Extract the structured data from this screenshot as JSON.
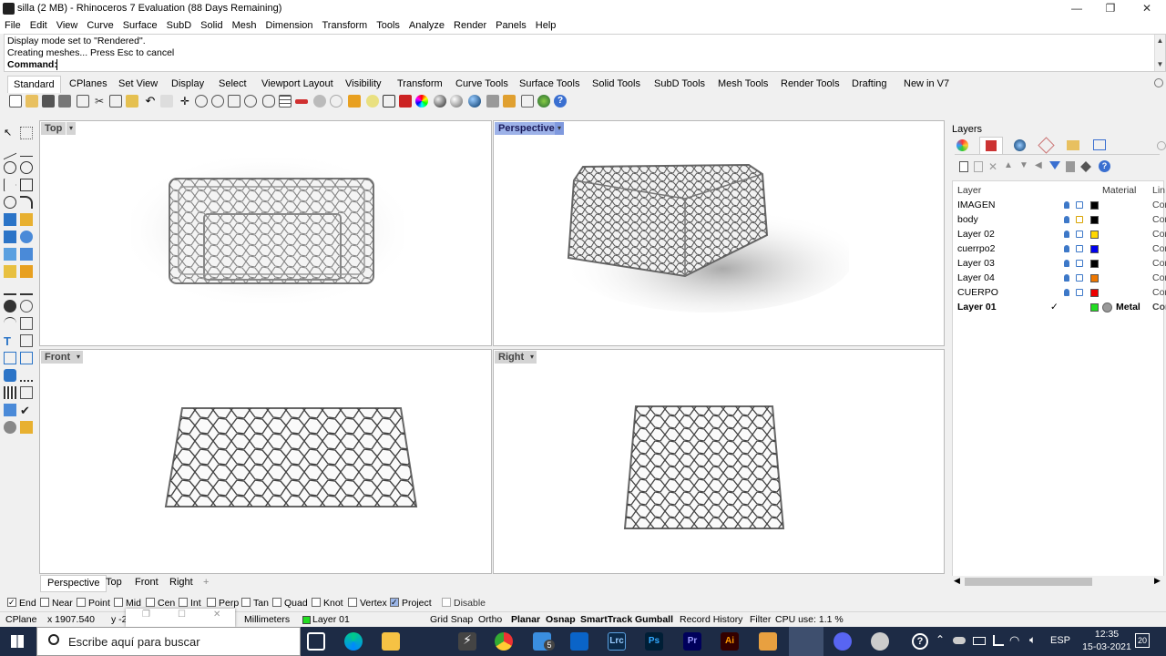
{
  "window": {
    "title": "silla (2 MB) - Rhinoceros 7 Evaluation (88 Days Remaining)",
    "min_icon": "—",
    "max_icon": "❐",
    "close_icon": "✕"
  },
  "menu": [
    "File",
    "Edit",
    "View",
    "Curve",
    "Surface",
    "SubD",
    "Solid",
    "Mesh",
    "Dimension",
    "Transform",
    "Tools",
    "Analyze",
    "Render",
    "Panels",
    "Help"
  ],
  "command": {
    "history": [
      "Display mode set to \"Rendered\".",
      "Creating meshes... Press Esc to cancel"
    ],
    "prompt": "Command:"
  },
  "toolbar_tabs": [
    "Standard",
    "CPlanes",
    "Set View",
    "Display",
    "Select",
    "Viewport Layout",
    "Visibility",
    "Transform",
    "Curve Tools",
    "Surface Tools",
    "Solid Tools",
    "SubD Tools",
    "Mesh Tools",
    "Render Tools",
    "Drafting",
    "New in V7"
  ],
  "viewports": {
    "top": "Top",
    "perspective": "Perspective",
    "front": "Front",
    "right": "Right",
    "dropdown": "▾"
  },
  "viewport_tabs": [
    "Perspective",
    "Top",
    "Front",
    "Right",
    "+"
  ],
  "layers": {
    "title": "Layers",
    "headers": {
      "layer": "Layer",
      "material": "Material",
      "linetype": "Lin"
    },
    "rows": [
      {
        "name": "IMAGEN",
        "color": "#000000",
        "linetype": "Cor"
      },
      {
        "name": "body",
        "color": "#000000",
        "linetype": "Cor"
      },
      {
        "name": "Layer 02",
        "color": "#ffd700",
        "linetype": "Cor"
      },
      {
        "name": "cuerrpo2",
        "color": "#0000ee",
        "linetype": "Cor"
      },
      {
        "name": "Layer 03",
        "color": "#000000",
        "linetype": "Cor"
      },
      {
        "name": "Layer 04",
        "color": "#ee7700",
        "linetype": "Cor"
      },
      {
        "name": "CUERPO",
        "color": "#ee0000",
        "linetype": "Cor"
      },
      {
        "name": "Layer 01",
        "color": "#22dd22",
        "linetype": "Cor",
        "current": true,
        "check": "✓",
        "material": "Metal"
      }
    ]
  },
  "osnaps": [
    {
      "label": "End",
      "checked": true
    },
    {
      "label": "Near",
      "checked": false
    },
    {
      "label": "Point",
      "checked": false
    },
    {
      "label": "Mid",
      "checked": false
    },
    {
      "label": "Cen",
      "checked": false
    },
    {
      "label": "Int",
      "checked": false
    },
    {
      "label": "Perp",
      "checked": false
    },
    {
      "label": "Tan",
      "checked": false
    },
    {
      "label": "Quad",
      "checked": false
    },
    {
      "label": "Knot",
      "checked": false
    },
    {
      "label": "Vertex",
      "checked": false
    },
    {
      "label": "Project",
      "checked": true
    },
    {
      "label": "Disable",
      "checked": false
    }
  ],
  "status": {
    "cplane": "CPlane",
    "x": "x 1907.540",
    "y": "y -2",
    "units": "Millimeters",
    "layer": "Layer 01",
    "grid_snap": "Grid Snap",
    "ortho": "Ortho",
    "planar": "Planar",
    "osnap": "Osnap",
    "smarttrack": "SmartTrack",
    "gumball": "Gumball",
    "record_history": "Record History",
    "filter": "Filter",
    "cpu": "CPU use: 1.1 %"
  },
  "taskbar": {
    "search_placeholder": "Escribe aquí para buscar",
    "lang": "ESP",
    "time": "12:35",
    "date": "15-03-2021",
    "notif": "20",
    "badge": "5",
    "apps": {
      "lrc": "Lrc",
      "ps": "Ps",
      "pr": "Pr",
      "ai": "Ai"
    }
  },
  "colors": {
    "active_viewport_label": "#9db2e8",
    "taskbar": "#1d2b45"
  }
}
